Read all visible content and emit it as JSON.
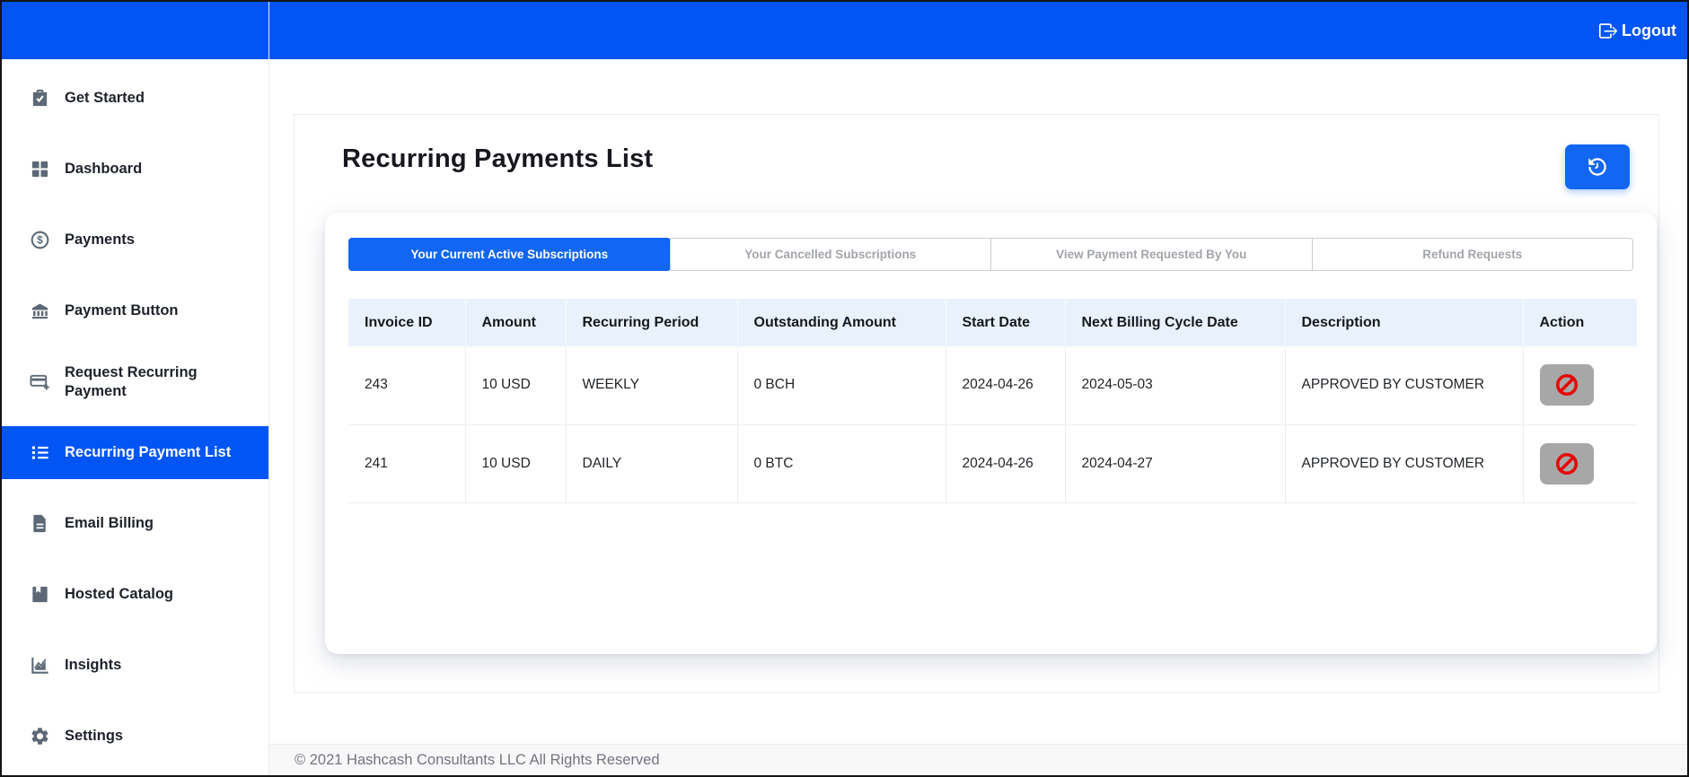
{
  "colors": {
    "topbar_blue": "#0255f5",
    "accent_blue": "#1266f1",
    "table_header_bg": "#e9f2fc",
    "action_button_bg": "#a7a7a7",
    "danger_red": "#e80000"
  },
  "topbar": {
    "logout_label": "Logout",
    "logout_icon": "box-arrow-right-icon"
  },
  "sidebar": {
    "items": [
      {
        "label": "Get Started",
        "icon": "clipboard-check-icon",
        "active": false
      },
      {
        "label": "Dashboard",
        "icon": "dashboard-grid-icon",
        "active": false
      },
      {
        "label": "Payments",
        "icon": "dollar-circle-icon",
        "active": false
      },
      {
        "label": "Payment Button",
        "icon": "bank-icon",
        "active": false
      },
      {
        "label": "Request Recurring Payment",
        "icon": "credit-card-plus-icon",
        "active": false
      },
      {
        "label": "Recurring Payment List",
        "icon": "list-icon",
        "active": true
      },
      {
        "label": "Email Billing",
        "icon": "document-icon",
        "active": false
      },
      {
        "label": "Hosted Catalog",
        "icon": "book-bookmark-icon",
        "active": false
      },
      {
        "label": "Insights",
        "icon": "chart-line-icon",
        "active": false
      },
      {
        "label": "Settings",
        "icon": "gear-icon",
        "active": false
      }
    ]
  },
  "page": {
    "title": "Recurring Payments List",
    "refresh_icon": "history-icon"
  },
  "tabs": [
    {
      "label": "Your Current Active Subscriptions",
      "active": true
    },
    {
      "label": "Your Cancelled Subscriptions",
      "active": false
    },
    {
      "label": "View Payment Requested By You",
      "active": false
    },
    {
      "label": "Refund Requests",
      "active": false
    }
  ],
  "table": {
    "columns": [
      "Invoice ID",
      "Amount",
      "Recurring Period",
      "Outstanding Amount",
      "Start Date",
      "Next Billing Cycle Date",
      "Description",
      "Action"
    ],
    "rows": [
      [
        "243",
        "10 USD",
        "WEEKLY",
        "0 BCH",
        "2024-04-26",
        "2024-05-03",
        "APPROVED BY CUSTOMER"
      ],
      [
        "241",
        "10 USD",
        "DAILY",
        "0 BTC",
        "2024-04-26",
        "2024-04-27",
        "APPROVED BY CUSTOMER"
      ]
    ],
    "action_icon": "no-entry-icon"
  },
  "footer": {
    "copyright": "© 2021 Hashcash Consultants LLC All Rights Reserved"
  }
}
